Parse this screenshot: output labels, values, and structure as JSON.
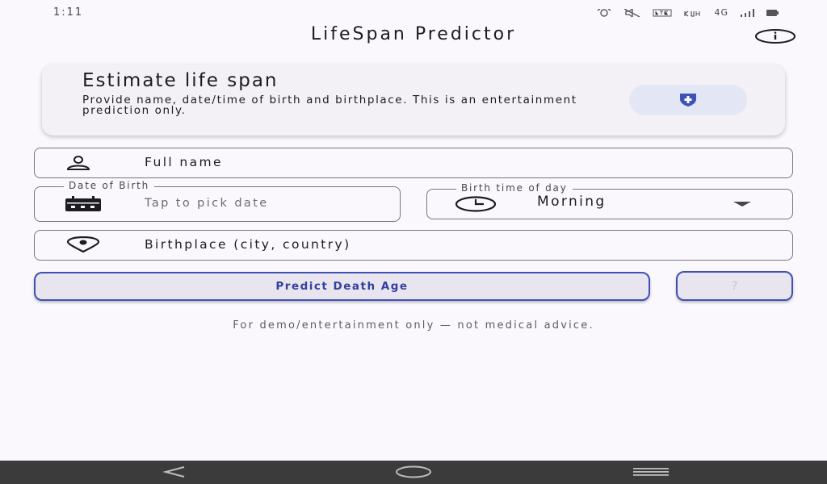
{
  "status_bar": {
    "time": "1:11",
    "network": "4G"
  },
  "app_bar": {
    "title": "LifeSpan Predictor",
    "info_icon": "info-icon"
  },
  "intro_card": {
    "title": "Estimate life span",
    "description": "Provide name, date/time of birth and birthplace. This is an entertainment prediction only.",
    "icon": "shield-plus-icon"
  },
  "form": {
    "full_name": {
      "placeholder": "Full name",
      "icon": "person-icon"
    },
    "date_of_birth": {
      "label": "Date of Birth",
      "placeholder": "Tap to pick date",
      "icon": "calendar-icon"
    },
    "birth_time": {
      "label": "Birth time of day",
      "value": "Morning",
      "icon": "clock-icon"
    },
    "birthplace": {
      "placeholder": "Birthplace (city, country)",
      "icon": "location-pin-icon"
    }
  },
  "actions": {
    "predict_label": "Predict Death Age",
    "help_label": "?"
  },
  "footnote": "For demo/entertainment only — not medical advice.",
  "colors": {
    "background": "#fbf8fd",
    "accent": "#3f51b5",
    "button_text": "#3340a0",
    "card": "#f3f1f6"
  }
}
